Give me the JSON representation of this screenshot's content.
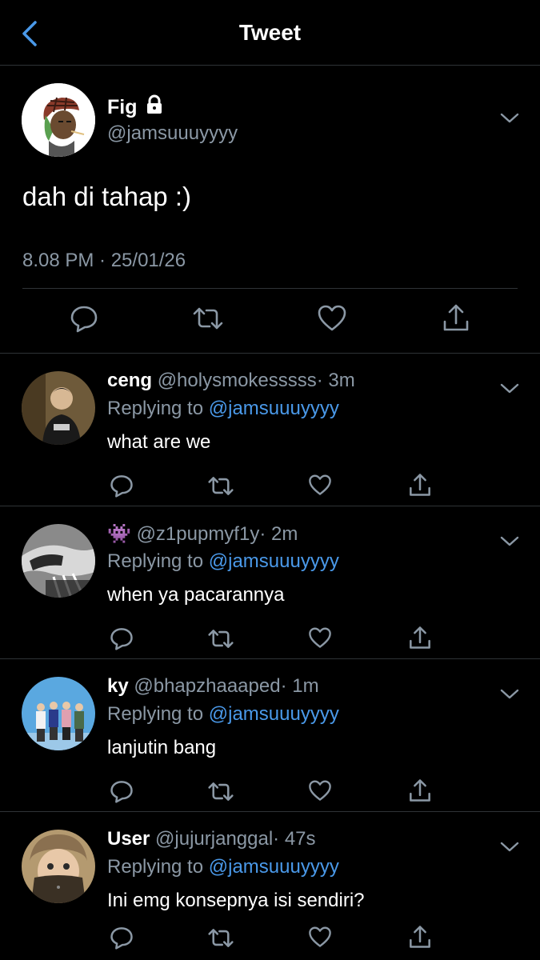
{
  "header": {
    "title": "Tweet",
    "back_icon": "chevron-left-icon"
  },
  "tweet": {
    "name": "Fig",
    "handle": "@jamsuuuyyyy",
    "text": "dah di tahap :)",
    "timestamp": "8.08 PM · 25/01/26",
    "locked": true
  },
  "replies": [
    {
      "name": "ceng",
      "handle": "@holysmokesssss",
      "time": "· 3m",
      "replying_prefix": "Replying to",
      "replying_to": "@jamsuuuyyyy",
      "text": "what are we"
    },
    {
      "name": "👾",
      "handle": "@z1pupmyf1y",
      "time": "· 2m",
      "replying_prefix": "Replying to",
      "replying_to": "@jamsuuuyyyy",
      "text": "when ya pacarannya"
    },
    {
      "name": "ky",
      "handle": "@bhapzhaaaped",
      "time": "· 1m",
      "replying_prefix": "Replying to",
      "replying_to": "@jamsuuuyyyy",
      "text": "lanjutin bang"
    },
    {
      "name": "User",
      "handle": "@jujurjanggal",
      "time": "· 47s",
      "replying_prefix": "Replying to",
      "replying_to": "@jamsuuuyyyy",
      "text": "Ini emg konsepnya isi sendiri?"
    }
  ],
  "colors": {
    "background": "#000000",
    "accent": "#4a99e9",
    "muted": "#8b98a5",
    "divider": "#2f3336"
  },
  "icons": [
    "reply-icon",
    "retweet-icon",
    "like-icon",
    "share-icon",
    "chevron-down-icon",
    "lock-icon"
  ]
}
